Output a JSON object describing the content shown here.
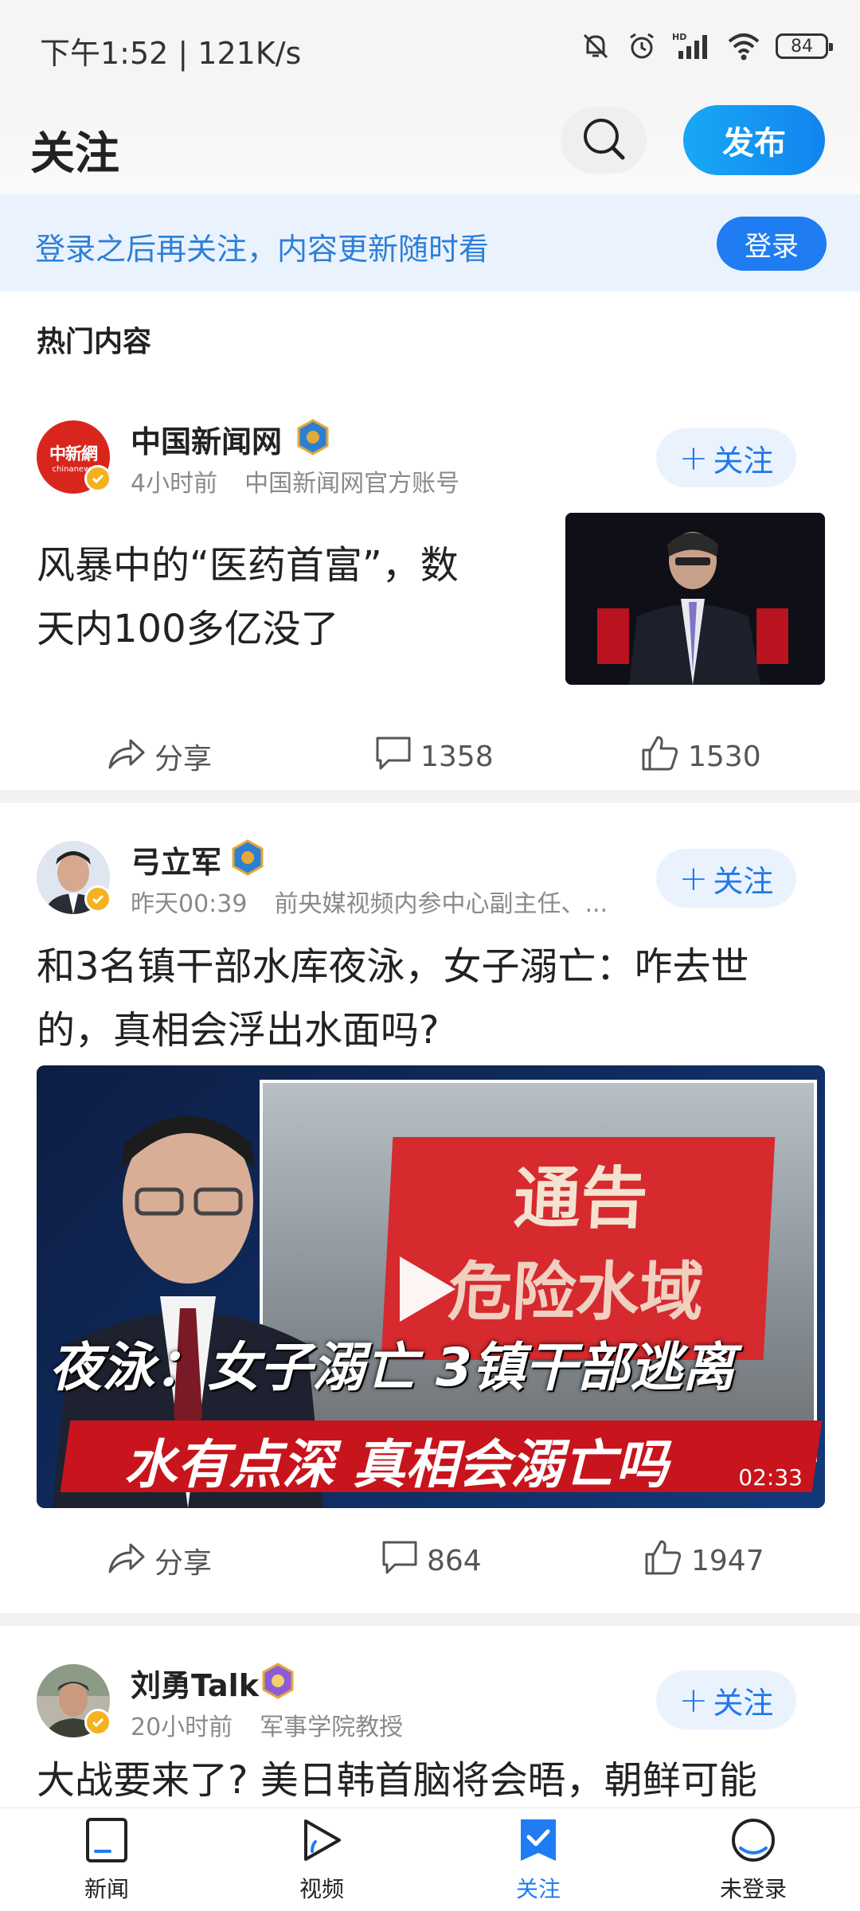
{
  "status_bar": {
    "time_speed": "下午1:52 | 121K/s",
    "battery": "84"
  },
  "header": {
    "title": "关注",
    "publish_label": "发布"
  },
  "login_banner": {
    "text": "登录之后再关注，内容更新随时看",
    "button_label": "登录"
  },
  "section_title": "热门内容",
  "posts": [
    {
      "author": "中国新闻网",
      "time": "4小时前",
      "desc": "中国新闻网官方账号",
      "follow_label": "关注",
      "headline_line1": "风暴中的“医药首富”，数",
      "headline_line2": "天内100多亿没了",
      "share_label": "分享",
      "comments": "1358",
      "likes": "1530",
      "avatar_text": "中新網",
      "avatar_subtext": "chinanews"
    },
    {
      "author": "弓立军",
      "time": "昨天00:39",
      "desc": "前央媒视频内参中心副主任、...",
      "follow_label": "关注",
      "headline_line1": "和3名镇干部水库夜泳，女子溺亡：咋去世",
      "headline_line2": "的，真相会浮出水面吗?",
      "video_sign_title": "通告",
      "video_sign_sub": "危险水域",
      "video_caption1": "夜泳：女子溺亡 3镇干部逃离",
      "video_caption2": "水有点深 真相会溺亡吗",
      "video_duration": "02:33",
      "share_label": "分享",
      "comments": "864",
      "likes": "1947"
    },
    {
      "author": "刘勇Talk",
      "time": "20小时前",
      "desc": "军事学院教授",
      "follow_label": "关注",
      "headline_line1": "大战要来了? 美日韩首脑将会晤，朝鲜可能"
    }
  ],
  "bottom_nav": [
    {
      "label": "新闻",
      "icon": "news-icon"
    },
    {
      "label": "视频",
      "icon": "video-play-icon"
    },
    {
      "label": "关注",
      "icon": "follow-check-icon",
      "active": true
    },
    {
      "label": "未登录",
      "icon": "user-icon"
    }
  ],
  "colors": {
    "accent": "#1f7cf2",
    "banner_bg": "#eaf3fd",
    "banner_text": "#2e7fd8",
    "meta_gray": "#8a8a8a"
  }
}
